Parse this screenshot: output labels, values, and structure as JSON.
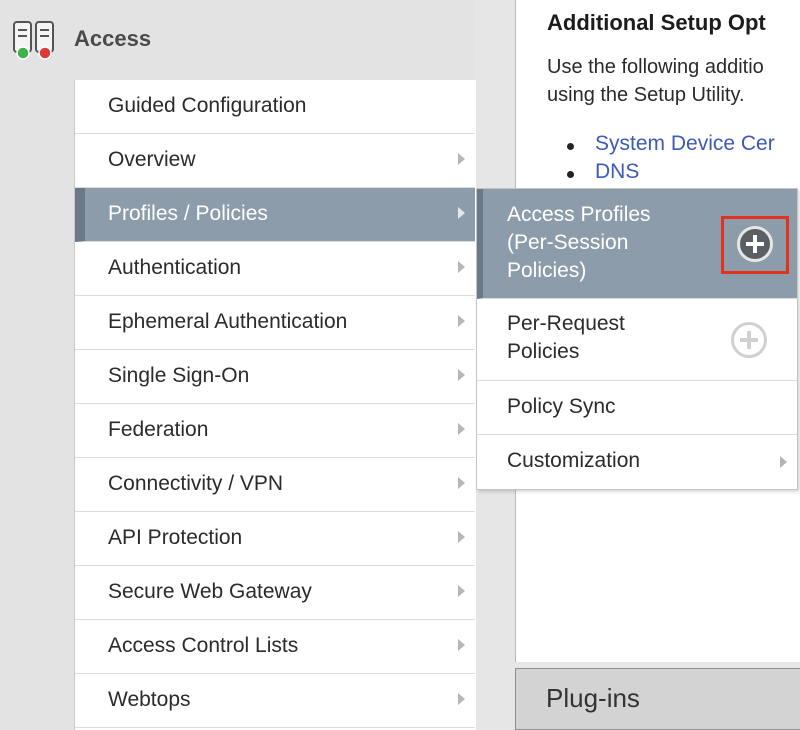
{
  "header": {
    "title": "Access",
    "icon": "access-servers-icon"
  },
  "main_menu": {
    "items": [
      {
        "label": "Guided Configuration",
        "has_submenu": false
      },
      {
        "label": "Overview",
        "has_submenu": true
      },
      {
        "label": "Profiles / Policies",
        "has_submenu": true,
        "active": true
      },
      {
        "label": "Authentication",
        "has_submenu": true
      },
      {
        "label": "Ephemeral Authentication",
        "has_submenu": true
      },
      {
        "label": "Single Sign-On",
        "has_submenu": true
      },
      {
        "label": "Federation",
        "has_submenu": true
      },
      {
        "label": "Connectivity / VPN",
        "has_submenu": true
      },
      {
        "label": "API Protection",
        "has_submenu": true
      },
      {
        "label": "Secure Web Gateway",
        "has_submenu": true
      },
      {
        "label": "Access Control Lists",
        "has_submenu": true
      },
      {
        "label": "Webtops",
        "has_submenu": true
      }
    ]
  },
  "submenu": {
    "items": [
      {
        "label_lines": [
          "Access Profiles",
          "(Per-Session",
          "Policies)"
        ],
        "active": true,
        "has_plus": true
      },
      {
        "label_lines": [
          "Per-Request",
          "Policies"
        ],
        "active": false,
        "has_plus": true
      },
      {
        "label_lines": [
          "Policy Sync"
        ],
        "active": false,
        "has_plus": false
      },
      {
        "label_lines": [
          "Customization"
        ],
        "active": false,
        "has_plus": false,
        "has_submenu": true
      }
    ]
  },
  "content": {
    "title": "Additional Setup Opt",
    "description_lines": [
      "Use the following additio",
      "using the Setup Utility."
    ],
    "links": [
      "System Device Cer",
      "DNS"
    ]
  },
  "plugins": {
    "label": "Plug-ins"
  },
  "colors": {
    "active_bg": "#8d9caa",
    "active_border": "#6a7985",
    "link": "#3c5ab8",
    "highlight_frame": "#e0321e"
  }
}
